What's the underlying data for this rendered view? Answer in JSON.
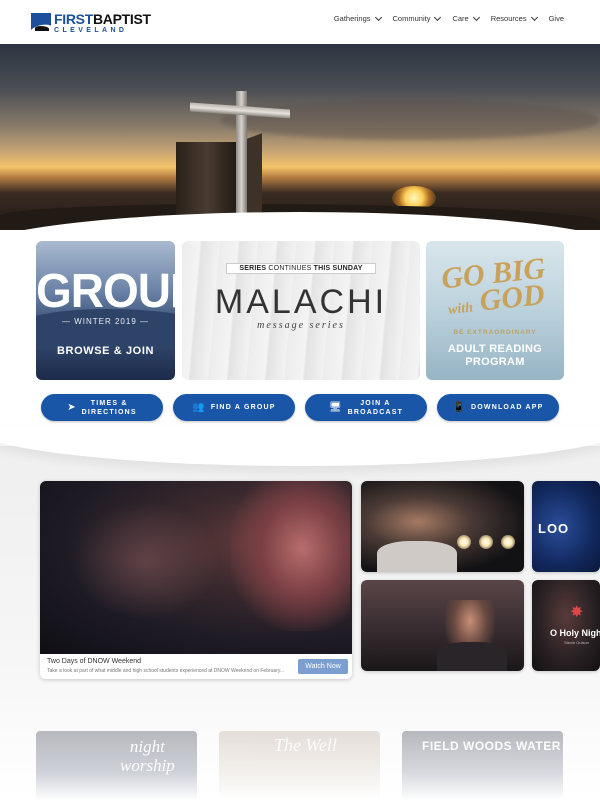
{
  "header": {
    "logo": {
      "line1_a": "FIRST",
      "line1_b": "BAPTIST",
      "line2": "CLEVELAND"
    },
    "nav": [
      {
        "label": "Gatherings",
        "has_dropdown": true
      },
      {
        "label": "Community",
        "has_dropdown": true
      },
      {
        "label": "Care",
        "has_dropdown": true
      },
      {
        "label": "Resources",
        "has_dropdown": true
      },
      {
        "label": "Give",
        "has_dropdown": false
      }
    ]
  },
  "promos": {
    "groups": {
      "title": "GROUPS",
      "subtitle": "— WINTER 2019 —",
      "cta": "BROWSE & JOIN"
    },
    "malachi": {
      "tag_bold": "SERIES",
      "tag_thin": "CONTINUES",
      "tag_end": "THIS SUNDAY",
      "title": "MALACHI",
      "subtitle": "message series"
    },
    "gobig": {
      "title_1": "GO BIG",
      "title_2": "with",
      "title_3": "GOD",
      "subtitle": "BE EXTRAORDINARY",
      "cta_1": "ADULT READING",
      "cta_2": "PROGRAM"
    }
  },
  "actions": [
    {
      "label_1": "TIMES &",
      "label_2": "DIRECTIONS",
      "icon": "location-arrow-icon",
      "glyph": "➤"
    },
    {
      "label_1": "FIND A GROUP",
      "label_2": "",
      "icon": "users-icon",
      "glyph": "👥"
    },
    {
      "label_1": "JOIN A",
      "label_2": "BROADCAST",
      "icon": "monitor-icon",
      "glyph": "🖥"
    },
    {
      "label_1": "DOWNLOAD APP",
      "label_2": "",
      "icon": "mobile-icon",
      "glyph": "📱"
    }
  ],
  "media": {
    "featured": {
      "title": "Two Days of DNOW Weekend",
      "description": "Take a look at part of what middle and high school students experienced at DNOW Weekend on February...",
      "button": "Watch Now"
    },
    "thumb_look": "LOO",
    "thumb_holy_title": "O Holy Night",
    "thumb_holy_sub": "Stevie Gulson"
  },
  "bottom_cards": [
    {
      "text_1": "night",
      "text_2": "worship"
    },
    {
      "text_1": "The Well",
      "text_2": ""
    },
    {
      "text_1": "FIELD WOODS WATER",
      "text_2": ""
    }
  ],
  "colors": {
    "brand_blue": "#1a56a8",
    "accent_gold": "#c9a15a"
  }
}
